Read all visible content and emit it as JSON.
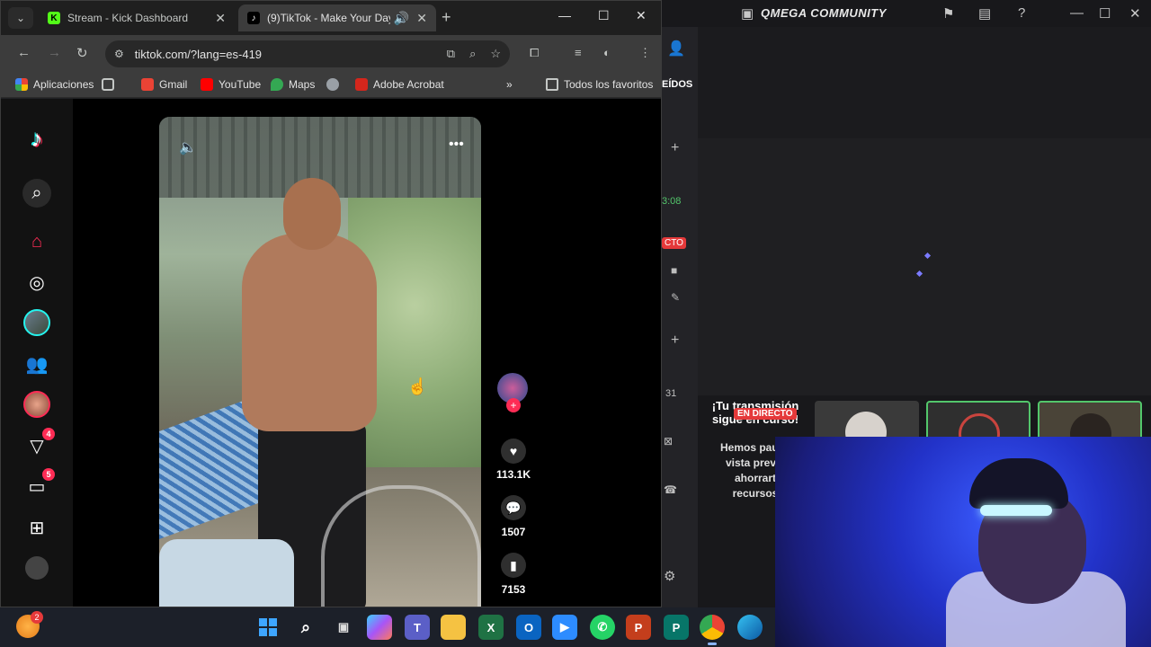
{
  "chrome": {
    "tabs": [
      {
        "title": "Stream - Kick Dashboard",
        "favicon": "K"
      },
      {
        "title": "(9)TikTok - Make Your Day",
        "favicon": "♪"
      }
    ],
    "url": "tiktok.com/?lang=es-419",
    "bookmarks": [
      "Aplicaciones",
      "Gmail",
      "YouTube",
      "Maps",
      "Adobe Acrobat",
      "Todos los favoritos"
    ]
  },
  "tiktok": {
    "sidebar_badges": {
      "messages": "4",
      "inbox": "5"
    },
    "actions": {
      "likes": "113.1K",
      "comments": "1507",
      "saves": "7153"
    }
  },
  "rightapp": {
    "title": "QMEGA COMMUNITY",
    "left_fragments": {
      "tab": "EÍDOS",
      "time": "3:08",
      "live": "CTO",
      "count": "31"
    },
    "live_banner": {
      "badge": "EN DIRECTO",
      "title": "¡Tu transmisión sigue en curso!",
      "body": [
        "Hemos pausa",
        "vista previa",
        "ahorrart",
        "recursos"
      ]
    }
  },
  "taskbar": {
    "weather_badge": "2"
  },
  "colors": {
    "tiktok_red": "#fe2c55",
    "tiktok_cyan": "#25f4ee",
    "kick_green": "#53fc18",
    "live_red": "#e5393a"
  }
}
